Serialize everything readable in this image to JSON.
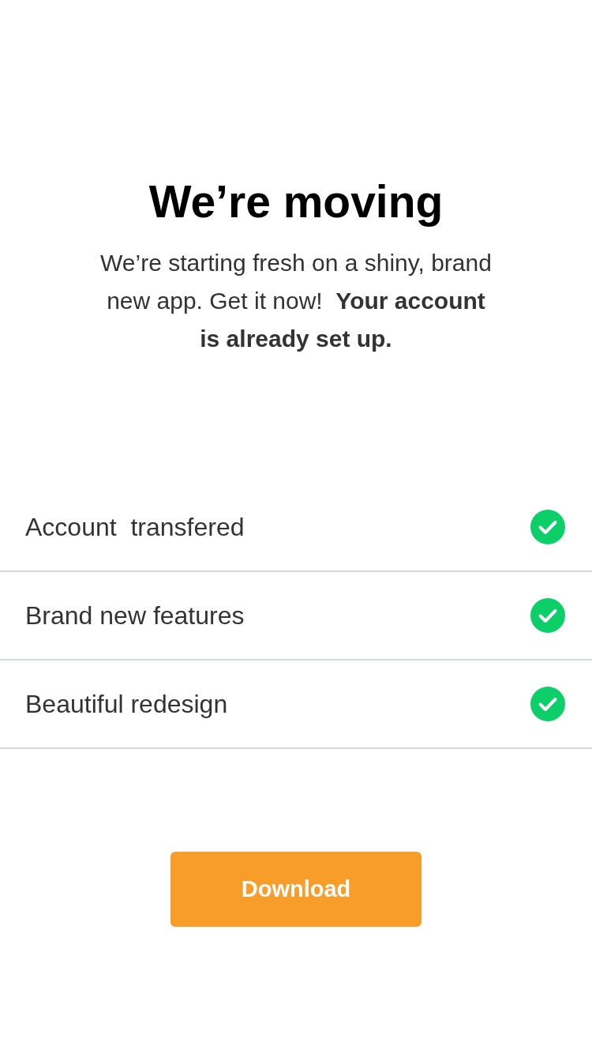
{
  "header": {
    "title": "We’re moving",
    "message": "We’re starting fresh on a shiny, brand new app. Get it now!  **Your account is already set up.**"
  },
  "features": [
    {
      "label": "Account  transfered",
      "done": true
    },
    {
      "label": "Brand new features",
      "done": true
    },
    {
      "label": "Beautiful redesign",
      "done": true
    }
  ],
  "button": {
    "label": "Download"
  }
}
